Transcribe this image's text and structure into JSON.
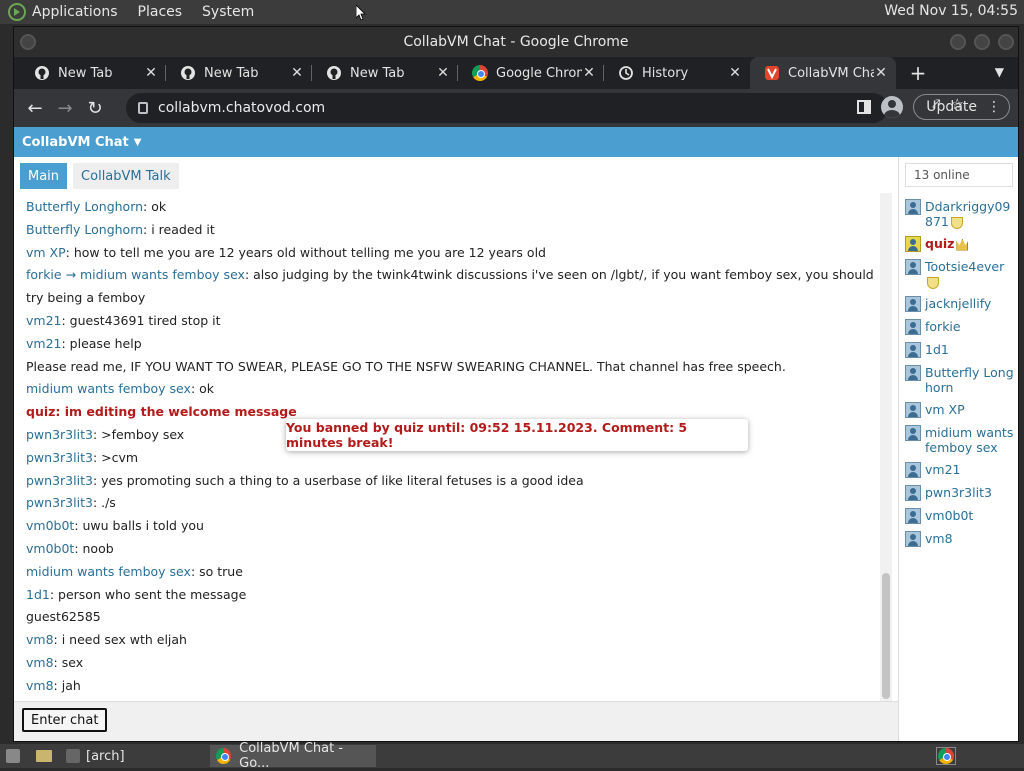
{
  "panel": {
    "menus": [
      "Applications",
      "Places",
      "System"
    ],
    "clock": "Wed Nov 15, 04:55"
  },
  "window": {
    "title": "CollabVM Chat - Google Chrome"
  },
  "tabs": [
    {
      "label": "New Tab",
      "icon": "github-icon"
    },
    {
      "label": "New Tab",
      "icon": "github-icon"
    },
    {
      "label": "New Tab",
      "icon": "github-icon"
    },
    {
      "label": "Google Chrom",
      "icon": "chrome-icon"
    },
    {
      "label": "History",
      "icon": "history-icon"
    },
    {
      "label": "CollabVM Cha",
      "icon": "collabvm-icon",
      "active": true
    }
  ],
  "toolbar": {
    "url": "collabvm.chatovod.com",
    "update_label": "Update"
  },
  "page": {
    "header": "CollabVM Chat",
    "chat_tabs": [
      "Main",
      "CollabVM Talk"
    ],
    "online": "13 online",
    "enter_chat": "Enter chat",
    "ban_message": "You banned by quiz until: 09:52 15.11.2023. Comment: 5 minutes break!",
    "messages": [
      {
        "user": "Butterfly Longhorn",
        "text": ": ok"
      },
      {
        "user": "Butterfly Longhorn",
        "text": ": i readed it"
      },
      {
        "user": "vm XP",
        "text": ": how to tell me you are 12 years old without telling me you are 12 years old"
      },
      {
        "user": "forkie → midium wants femboy sex",
        "text": ": also judging by the twink4twink discussions i've seen on /lgbt/, if you want femboy sex, you should try being a femboy"
      },
      {
        "user": "vm21",
        "text": ": guest43691 tired stop it"
      },
      {
        "user": "vm21",
        "text": ": please help"
      },
      {
        "user": "",
        "text": "Please read me, IF YOU WANT TO SWEAR, PLEASE GO TO THE NSFW SWEARING CHANNEL. That channel has free speech."
      },
      {
        "user": "midium wants femboy sex",
        "text": ": ok"
      },
      {
        "user": "quiz",
        "text": ": im editing the welcome message",
        "red": true
      },
      {
        "user": "pwn3r3lit3",
        "text": ": >femboy sex"
      },
      {
        "user": "pwn3r3lit3",
        "text": ": >cvm"
      },
      {
        "user": "pwn3r3lit3",
        "text": ": yes promoting such a thing to a userbase of like literal fetuses is a good idea"
      },
      {
        "user": "pwn3r3lit3",
        "text": ": ./s"
      },
      {
        "user": "vm0b0t",
        "text": ": uwu balls i told you"
      },
      {
        "user": "vm0b0t",
        "text": ": noob"
      },
      {
        "user": "midium wants femboy sex",
        "text": ": so true"
      },
      {
        "user": "1d1",
        "text": ": person who sent the message"
      },
      {
        "user": "",
        "text": "guest62585"
      },
      {
        "user": "vm8",
        "text": ": i need sex wth eljah"
      },
      {
        "user": "vm8",
        "text": ": sex"
      },
      {
        "user": "vm8",
        "text": ": jah"
      }
    ],
    "users": [
      {
        "name": "Ddarkriggy09871",
        "badge": "shield"
      },
      {
        "name": "quiz",
        "badge": "crown",
        "admin": true
      },
      {
        "name": "Tootsie4ever",
        "badge": "shield"
      },
      {
        "name": "jacknjellify"
      },
      {
        "name": "forkie"
      },
      {
        "name": "1d1"
      },
      {
        "name": "Butterfly Longhorn"
      },
      {
        "name": "vm XP"
      },
      {
        "name": "midium wants femboy sex"
      },
      {
        "name": "vm21"
      },
      {
        "name": "pwn3r3lit3"
      },
      {
        "name": "vm0b0t"
      },
      {
        "name": "vm8"
      }
    ]
  },
  "taskbar": {
    "items": [
      "[arch]",
      "CollabVM Chat - Go..."
    ]
  }
}
